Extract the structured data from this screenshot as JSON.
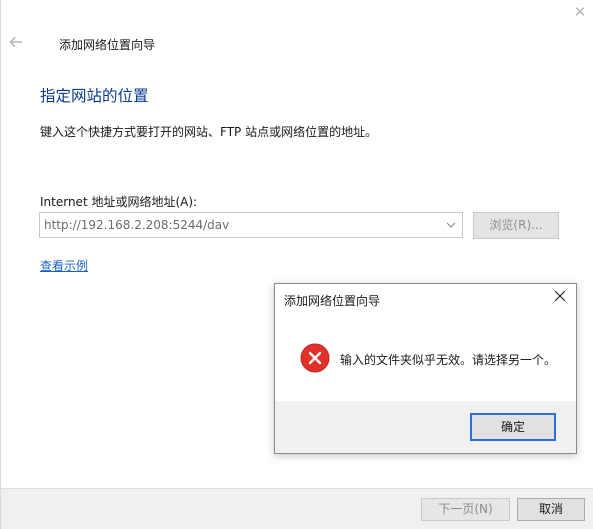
{
  "wizard": {
    "title": "添加网络位置向导",
    "heading": "指定网站的位置",
    "description": "键入这个快捷方式要打开的网站、FTP 站点或网络位置的地址。",
    "address_label": "Internet 地址或网络地址(A):",
    "address_value": "http://192.168.2.208:5244/dav",
    "browse_label": "浏览(R)...",
    "example_link": "查看示例",
    "next_label": "下一页(N)",
    "cancel_label": "取消",
    "icons": {
      "close": "close-icon",
      "back": "back-arrow-icon",
      "dropdown": "chevron-down-icon"
    }
  },
  "dialog": {
    "title": "添加网络位置向导",
    "message": "输入的文件夹似乎无效。请选择另一个。",
    "ok_label": "确定",
    "icons": {
      "error": "error-icon",
      "close": "close-icon"
    }
  },
  "colors": {
    "heading": "#0a3d91",
    "link": "#1a63c5",
    "error_red": "#e0312b",
    "focus_border": "#2a6fd6"
  }
}
